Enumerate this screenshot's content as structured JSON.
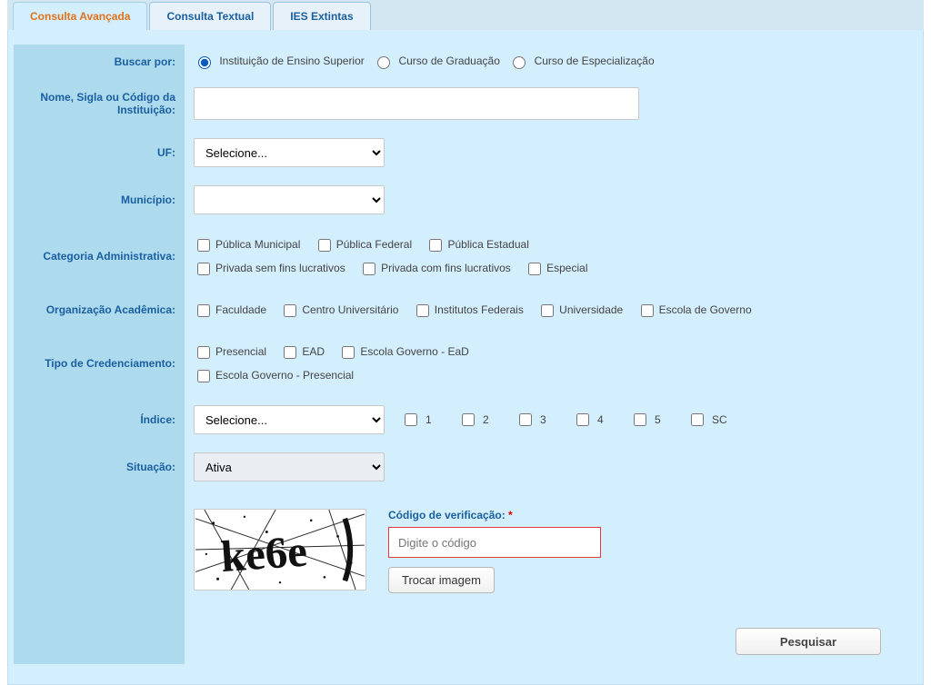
{
  "tabs": {
    "advanced": "Consulta Avançada",
    "textual": "Consulta Textual",
    "extinct": "IES Extintas"
  },
  "labels": {
    "buscar_por": "Buscar por:",
    "nome": "Nome, Sigla ou Código da Instituição:",
    "uf": "UF:",
    "municipio": "Município:",
    "categoria": "Categoria Administrativa:",
    "organizacao": "Organização Acadêmica:",
    "tipo_cred": "Tipo de Credenciamento:",
    "indice": "Índice:",
    "situacao": "Situação:"
  },
  "buscar_por": {
    "opt1": "Instituição de Ensino Superior",
    "opt2": "Curso de Graduação",
    "opt3": "Curso de Especialização",
    "selected": "opt1"
  },
  "nome_value": "",
  "uf": {
    "placeholder": "Selecione..."
  },
  "municipio": {
    "placeholder": ""
  },
  "categoria": {
    "c1": "Pública Municipal",
    "c2": "Pública Federal",
    "c3": "Pública Estadual",
    "c4": "Privada sem fins lucrativos",
    "c5": "Privada com fins lucrativos",
    "c6": "Especial"
  },
  "organizacao": {
    "o1": "Faculdade",
    "o2": "Centro Universitário",
    "o3": "Institutos Federais",
    "o4": "Universidade",
    "o5": "Escola de Governo"
  },
  "tipo_cred": {
    "t1": "Presencial",
    "t2": "EAD",
    "t3": "Escola Governo - EaD",
    "t4": "Escola Governo - Presencial"
  },
  "indice": {
    "placeholder": "Selecione...",
    "v1": "1",
    "v2": "2",
    "v3": "3",
    "v4": "4",
    "v5": "5",
    "sc": "SC"
  },
  "situacao": {
    "selected": "Ativa"
  },
  "captcha": {
    "label": "Código de verificação:",
    "required_mark": "*",
    "placeholder": "Digite o código",
    "trocar": "Trocar imagem",
    "image_text": "ke6e"
  },
  "buttons": {
    "pesquisar": "Pesquisar"
  }
}
